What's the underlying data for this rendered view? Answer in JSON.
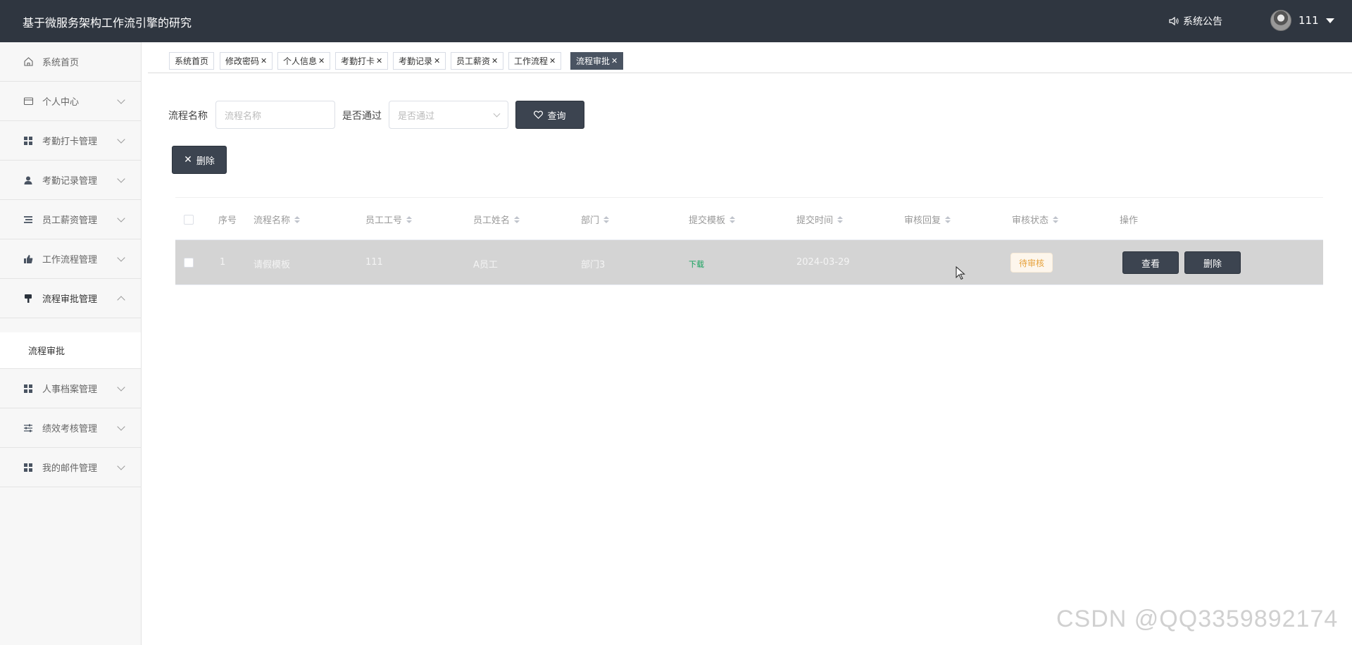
{
  "header": {
    "app_title": "基于微服务架构工作流引擎的研究",
    "notice_label": "系统公告",
    "username": "111"
  },
  "sidebar": {
    "items": [
      {
        "label": "系统首页",
        "icon": "home-icon"
      },
      {
        "label": "个人中心",
        "icon": "card-icon"
      },
      {
        "label": "考勤打卡管理",
        "icon": "grid-icon"
      },
      {
        "label": "考勤记录管理",
        "icon": "user-icon"
      },
      {
        "label": "员工薪资管理",
        "icon": "list-icon"
      },
      {
        "label": "工作流程管理",
        "icon": "thumb-icon"
      },
      {
        "label": "流程审批管理",
        "icon": "brush-icon"
      },
      {
        "label": "人事档案管理",
        "icon": "grid-icon"
      },
      {
        "label": "绩效考核管理",
        "icon": "sliders-icon"
      },
      {
        "label": "我的邮件管理",
        "icon": "grid-icon"
      }
    ],
    "sub_item": "流程审批"
  },
  "tabs": [
    {
      "label": "系统首页",
      "closable": false
    },
    {
      "label": "修改密码",
      "closable": true
    },
    {
      "label": "个人信息",
      "closable": true
    },
    {
      "label": "考勤打卡",
      "closable": true
    },
    {
      "label": "考勤记录",
      "closable": true
    },
    {
      "label": "员工薪资",
      "closable": true
    },
    {
      "label": "工作流程",
      "closable": true
    },
    {
      "label": "流程审批",
      "closable": true,
      "active": true
    }
  ],
  "search": {
    "name_label": "流程名称",
    "name_placeholder": "流程名称",
    "pass_label": "是否通过",
    "pass_placeholder": "是否通过",
    "query_button": "查询",
    "delete_button": "删除"
  },
  "table": {
    "columns": [
      "序号",
      "流程名称",
      "员工工号",
      "员工姓名",
      "部门",
      "提交模板",
      "提交时间",
      "审核回复",
      "审核状态",
      "操作"
    ],
    "rows": [
      {
        "index": "1",
        "flow_name": "请假模板",
        "emp_no": "111",
        "emp_name": "A员工",
        "dept": "部门3",
        "template": "下载",
        "submit_time": "2024-03-29",
        "reply": "",
        "status": "待审核",
        "view_button": "查看",
        "delete_button": "删除"
      }
    ]
  },
  "watermark": "CSDN @QQ3359892174",
  "colors": {
    "topbar": "#2f3640",
    "button_dark": "#3c4450",
    "status_pending": "#e6a23c",
    "link_green": "#13a05b"
  }
}
